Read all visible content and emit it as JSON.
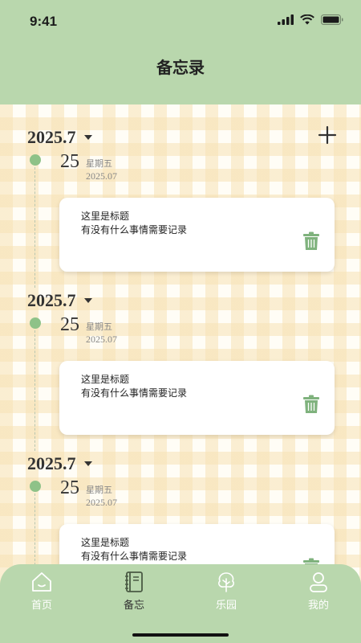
{
  "status_bar": {
    "time": "9:41"
  },
  "header": {
    "title": "备忘录"
  },
  "sections": [
    {
      "month": "2025.7",
      "day": "25",
      "weekday": "星期五",
      "date": "2025.07",
      "card": {
        "title": "这里是标题",
        "body": "有没有什么事情需要记录"
      }
    },
    {
      "month": "2025.7",
      "day": "25",
      "weekday": "星期五",
      "date": "2025.07",
      "card": {
        "title": "这里是标题",
        "body": "有没有什么事情需要记录"
      }
    },
    {
      "month": "2025.7",
      "day": "25",
      "weekday": "星期五",
      "date": "2025.07",
      "card": {
        "title": "这里是标题",
        "body": "有没有什么事情需要记录"
      }
    }
  ],
  "tabs": [
    {
      "label": "首页",
      "icon": "home-icon"
    },
    {
      "label": "备忘",
      "icon": "notebook-icon",
      "active": true
    },
    {
      "label": "乐园",
      "icon": "tree-icon"
    },
    {
      "label": "我的",
      "icon": "user-icon"
    }
  ],
  "colors": {
    "primary_green": "#b9d7ad",
    "dot_green": "#8ec288",
    "trash_green": "#7fb27d"
  }
}
